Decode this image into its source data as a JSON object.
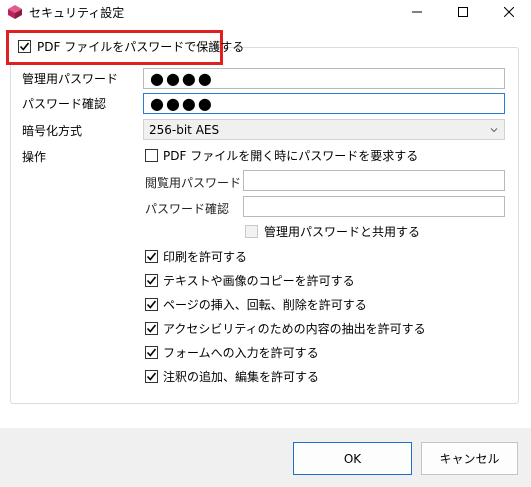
{
  "window": {
    "title": "セキュリティ設定",
    "icons": {
      "app": "app-logo-icon",
      "minimize": "minimize-icon",
      "maximize": "maximize-icon",
      "close": "close-icon"
    }
  },
  "protect": {
    "label": "PDF ファイルをパスワードで保護する",
    "checked": true
  },
  "owner_password": {
    "label": "管理用パスワード",
    "value": "●●●●"
  },
  "owner_confirm": {
    "label": "パスワード確認",
    "value": "●●●●"
  },
  "encryption": {
    "label": "暗号化方式",
    "selected": "256-bit AES"
  },
  "operations": {
    "label": "操作",
    "require_open_password": {
      "label": "PDF ファイルを開く時にパスワードを要求する",
      "checked": false
    },
    "viewer_password": {
      "label": "閲覧用パスワード",
      "value": ""
    },
    "viewer_confirm": {
      "label": "パスワード確認",
      "value": ""
    },
    "share_with_owner": {
      "label": "管理用パスワードと共用する",
      "checked": false,
      "disabled": true
    },
    "permissions": [
      {
        "label": "印刷を許可する",
        "checked": true
      },
      {
        "label": "テキストや画像のコピーを許可する",
        "checked": true
      },
      {
        "label": "ページの挿入、回転、削除を許可する",
        "checked": true
      },
      {
        "label": "アクセシビリティのための内容の抽出を許可する",
        "checked": true
      },
      {
        "label": "フォームへの入力を許可する",
        "checked": true
      },
      {
        "label": "注釈の追加、編集を許可する",
        "checked": true
      }
    ]
  },
  "buttons": {
    "ok": "OK",
    "cancel": "キャンセル"
  },
  "colors": {
    "highlight": "#e02020",
    "focus": "#2b7ad6",
    "primary_border": "#1c6ec8",
    "footer_bg": "#f0f0f0"
  }
}
